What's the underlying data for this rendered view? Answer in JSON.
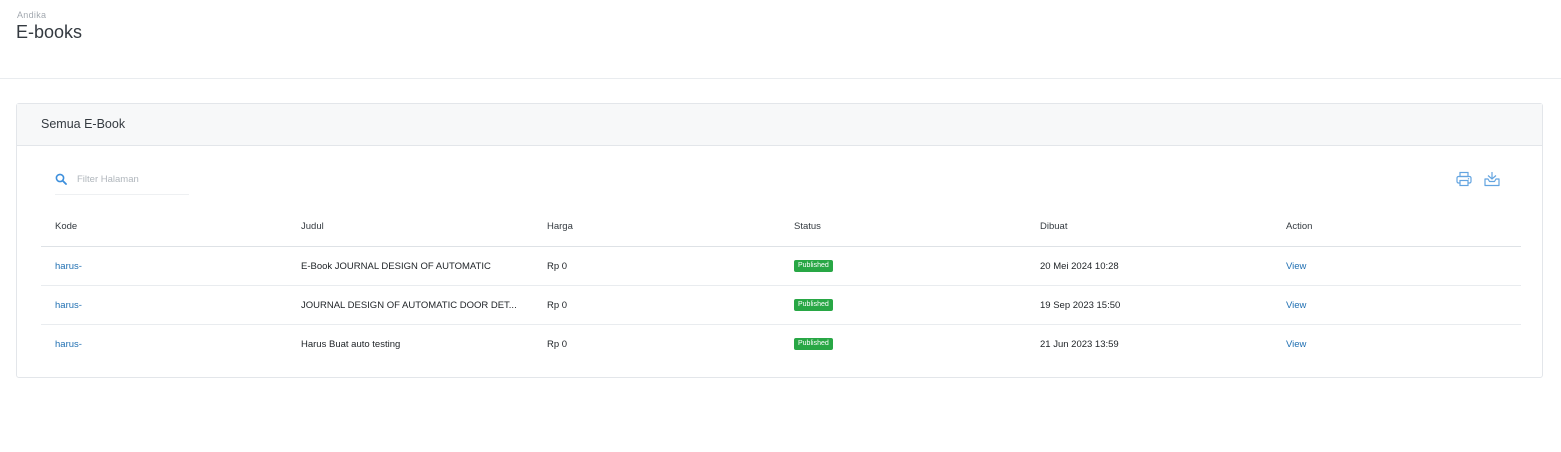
{
  "header": {
    "breadcrumb": "Andika",
    "title": "E-books"
  },
  "card": {
    "title": "Semua E-Book"
  },
  "search": {
    "placeholder": "Filter Halaman",
    "value": ""
  },
  "icons": {
    "search": "search-icon",
    "print": "printer-icon",
    "export": "download-tray-icon"
  },
  "colors": {
    "accent": "#1f6fb2",
    "badge": "#28a745",
    "icon": "#63a4e0"
  },
  "table": {
    "columns": [
      "Kode",
      "Judul",
      "Harga",
      "Status",
      "Dibuat",
      "Action"
    ],
    "rows": [
      {
        "kode": "harus-",
        "judul": "E-Book JOURNAL DESIGN OF AUTOMATIC",
        "harga": "Rp 0",
        "status": "Published",
        "dibuat": "20 Mei 2024 10:28",
        "action": "View"
      },
      {
        "kode": "harus-",
        "judul": "JOURNAL DESIGN OF AUTOMATIC DOOR DET...",
        "harga": "Rp 0",
        "status": "Published",
        "dibuat": "19 Sep 2023 15:50",
        "action": "View"
      },
      {
        "kode": "harus-",
        "judul": "Harus Buat auto testing",
        "harga": "Rp 0",
        "status": "Published",
        "dibuat": "21 Jun 2023 13:59",
        "action": "View"
      }
    ]
  }
}
